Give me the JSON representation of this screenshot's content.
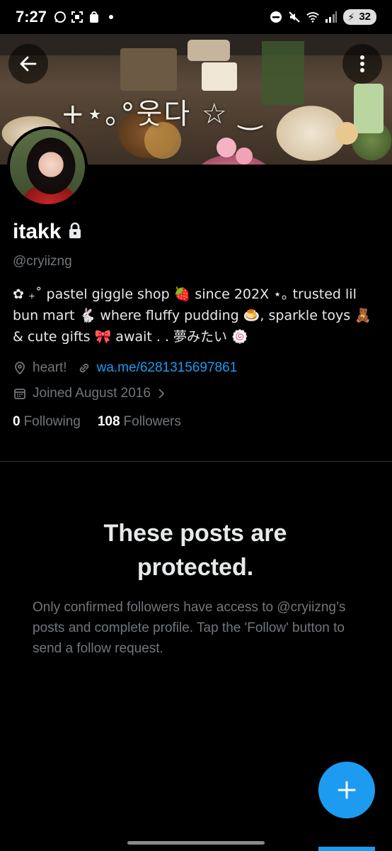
{
  "status_bar": {
    "time": "7:27",
    "battery": "32"
  },
  "banner": {
    "title": "+⋆｡°웃다 ☆ ‿"
  },
  "profile": {
    "display_name": "itakk",
    "handle": "@cryiizng",
    "bio": "✿ ₊˚ pastel giggle shop 🍓 since 202X ⋆｡ trusted lil bun mart 🐇 where fluffy pudding 🍮, sparkle toys 🧸 & cute gifts 🎀 await . . 夢みたい 🍥",
    "location": "heart!",
    "website": "wa.me/6281315697861",
    "joined": "Joined August 2016",
    "following_count": "0",
    "following_label": "Following",
    "followers_count": "108",
    "followers_label": "Followers"
  },
  "protected": {
    "title": "These posts are protected.",
    "body": "Only confirmed followers have access to @cryiizng’s posts and complete profile. Tap the 'Follow' button to send a follow request."
  },
  "colors": {
    "background": "#000000",
    "text_primary": "#e7e9ea",
    "text_secondary": "#71767b",
    "accent": "#1d9bf0"
  }
}
